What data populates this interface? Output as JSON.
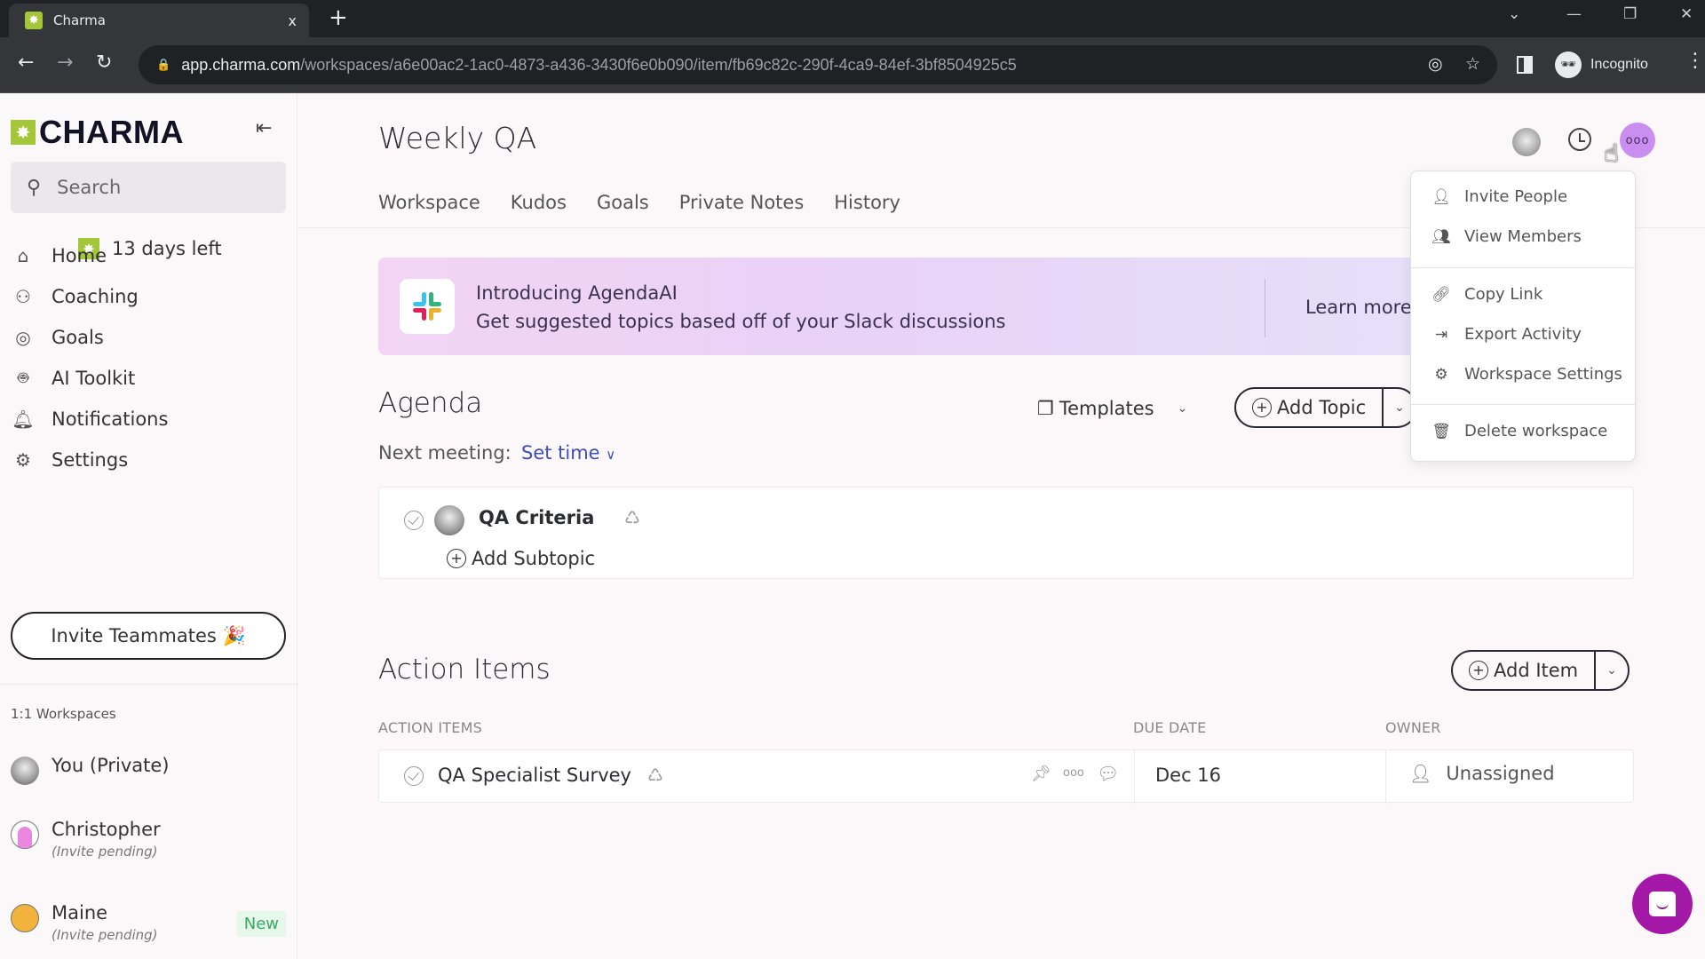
{
  "browser": {
    "tab_title": "Charma",
    "tab_close": "x",
    "new_tab": "+",
    "url_host": "app.charma.com",
    "url_path": "/workspaces/a6e00ac2-1ac0-4873-a436-3430f6e0b090/item/fb69c82c-290f-4ca9-84ef-3bf8504925c5",
    "profile_label": "Incognito"
  },
  "sidebar": {
    "brand": "CHARMA",
    "search_placeholder": "Search",
    "trial": "13 days left",
    "nav": [
      {
        "label": "Home",
        "icon": "home-heart-icon"
      },
      {
        "label": "Coaching",
        "icon": "coaching-whistle-icon"
      },
      {
        "label": "Goals",
        "icon": "target-icon"
      },
      {
        "label": "AI Toolkit",
        "icon": "robot-icon"
      },
      {
        "label": "Notifications",
        "icon": "bell-icon"
      },
      {
        "label": "Settings",
        "icon": "gear-icon"
      }
    ],
    "invite_button": "Invite Teammates 🎉",
    "workspaces_heading": "1:1 Workspaces",
    "workspaces": [
      {
        "name": "You (Private)",
        "sub": ""
      },
      {
        "name": "Christopher",
        "sub": "(Invite pending)"
      },
      {
        "name": "Maine",
        "sub": "(Invite pending)",
        "badge": "New"
      }
    ]
  },
  "header": {
    "title": "Weekly QA",
    "tabs": [
      "Workspace",
      "Kudos",
      "Goals",
      "Private Notes",
      "History"
    ],
    "more_dots": "ooo"
  },
  "banner": {
    "title": "Introducing AgendaAI",
    "subtitle": "Get suggested topics based off of your Slack discussions",
    "learn_more": "Learn more"
  },
  "agenda": {
    "title": "Agenda",
    "next_meeting_label": "Next meeting:",
    "set_time": "Set time",
    "templates": "Templates",
    "add_topic": "Add Topic",
    "topics": [
      {
        "title": "QA Criteria",
        "add_subtopic": "Add Subtopic"
      }
    ]
  },
  "action_items": {
    "title": "Action Items",
    "add_item": "Add Item",
    "columns": [
      "ACTION ITEMS",
      "DUE DATE",
      "OWNER"
    ],
    "rows": [
      {
        "title": "QA Specialist Survey",
        "due": "Dec 16",
        "owner": "Unassigned"
      }
    ]
  },
  "menu": {
    "items": [
      {
        "label": "Invite People",
        "icon": "add-user-icon"
      },
      {
        "label": "View Members",
        "icon": "users-icon"
      },
      {
        "label": "Copy Link",
        "icon": "link-icon"
      },
      {
        "label": "Export Activity",
        "icon": "export-icon"
      },
      {
        "label": "Workspace Settings",
        "icon": "gear-icon"
      },
      {
        "label": "Delete workspace",
        "icon": "trash-icon"
      }
    ]
  },
  "colors": {
    "brand_green": "#a4c639",
    "accent_purple": "#c98ef0",
    "link_blue": "#3e4db8",
    "chat_fab": "#a418a8",
    "new_badge": "#3aa865"
  }
}
